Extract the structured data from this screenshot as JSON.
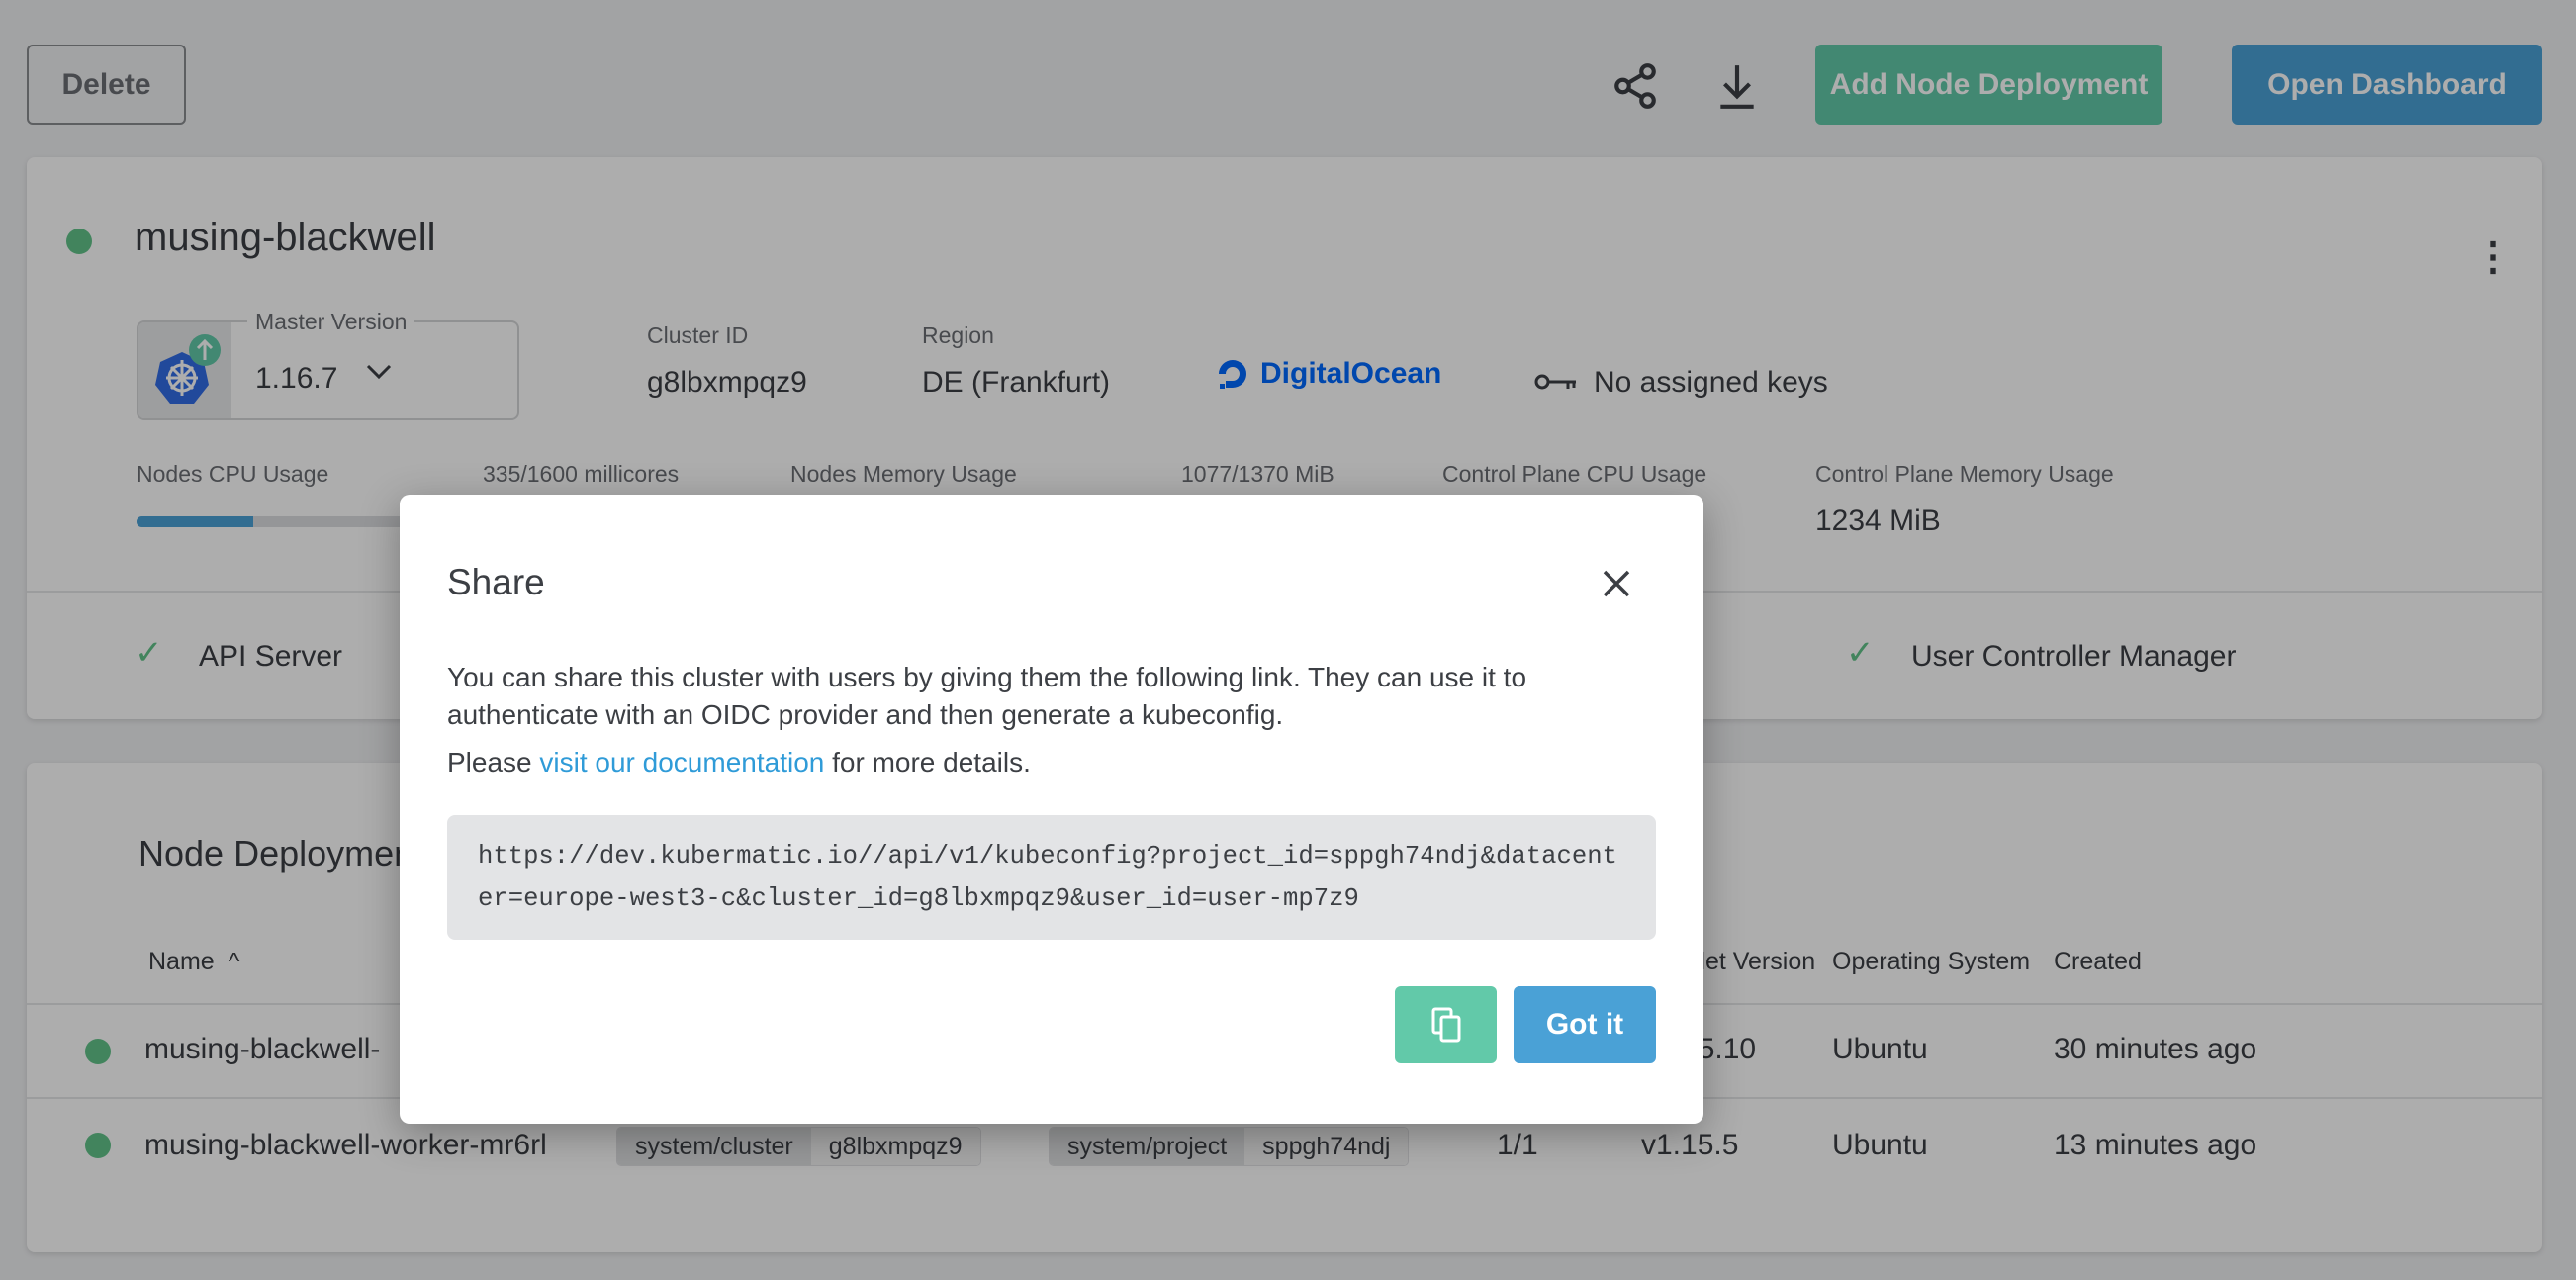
{
  "toolbar": {
    "delete_label": "Delete",
    "add_node_label": "Add Node Deployment",
    "open_dashboard_label": "Open Dashboard"
  },
  "colors": {
    "green": "#62c9a9",
    "blue": "#4aa1d6",
    "status_ok": "#62c38a",
    "link": "#2f9bd8",
    "overlay": "rgba(0,0,0,0.32)"
  },
  "cluster": {
    "name": "musing-blackwell",
    "master_version_label": "Master Version",
    "master_version": "1.16.7",
    "cluster_id_label": "Cluster ID",
    "cluster_id": "g8lbxmpqz9",
    "region_label": "Region",
    "region": "DE (Frankfurt)",
    "provider": "DigitalOcean",
    "keys": "No assigned keys",
    "usage": {
      "nodes_cpu_label": "Nodes CPU Usage",
      "nodes_cpu_value": "335/1600 millicores",
      "nodes_cpu_fraction": 0.21,
      "nodes_mem_label": "Nodes Memory Usage",
      "nodes_mem_value": "1077/1370 MiB",
      "cp_cpu_label": "Control Plane CPU Usage",
      "cp_mem_label": "Control Plane Memory Usage",
      "cp_mem_value": "1234 MiB"
    },
    "health": [
      "API Server",
      "User Controller Manager"
    ]
  },
  "node_deployments": {
    "title": "Node Deployments",
    "columns": {
      "name": "Name",
      "kubelet": "Kubelet Version",
      "os": "Operating System",
      "created": "Created"
    },
    "rows": [
      {
        "name": "musing-blackwell-",
        "kubelet": "v1.15.10",
        "os": "Ubuntu",
        "created": "30 minutes ago"
      },
      {
        "name": "musing-blackwell-worker-mr6rl",
        "label1_key": "system/cluster",
        "label1_val": "g8lbxmpqz9",
        "label2_key": "system/project",
        "label2_val": "sppgh74ndj",
        "replicas": "1/1",
        "kubelet": "v1.15.5",
        "os": "Ubuntu",
        "created": "13 minutes ago"
      }
    ]
  },
  "dialog": {
    "title": "Share",
    "text1": "You can share this cluster with users by giving them the following link. They can use it to authenticate with an OIDC provider and then generate a kubeconfig.",
    "text2_pre": "Please ",
    "text2_link": "visit our documentation",
    "text2_post": " for more details.",
    "url": "https://dev.kubermatic.io//api/v1/kubeconfig?project_id=sppgh74ndj&datacenter=europe-west3-c&cluster_id=g8lbxmpqz9&user_id=user-mp7z9",
    "got_it_label": "Got it"
  }
}
